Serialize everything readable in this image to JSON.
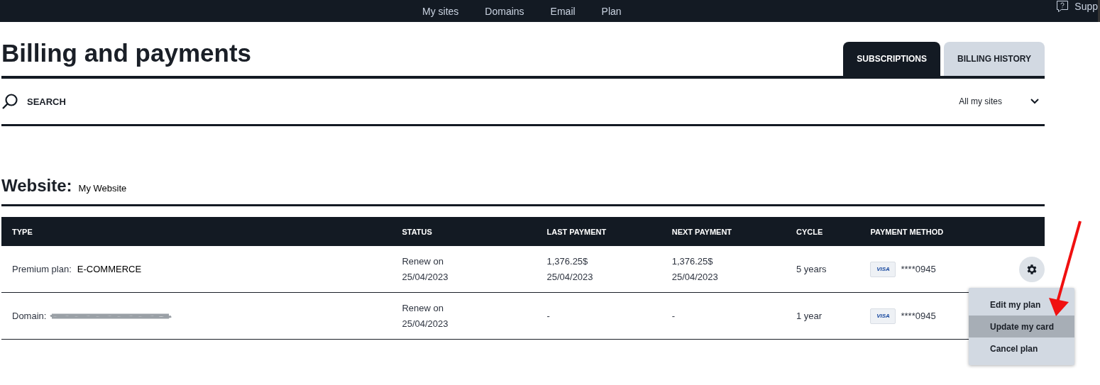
{
  "top_nav": {
    "items": [
      "My sites",
      "Domains",
      "Email",
      "Plan"
    ],
    "support": "Supp"
  },
  "page_title": "Billing and payments",
  "tabs": [
    {
      "label": "SUBSCRIPTIONS",
      "selected": true
    },
    {
      "label": "BILLING HISTORY",
      "selected": false
    }
  ],
  "search": {
    "label": "SEARCH"
  },
  "site_filter": {
    "value": "All my sites"
  },
  "website": {
    "label": "Website:",
    "name": "My Website"
  },
  "table": {
    "columns": [
      "TYPE",
      "STATUS",
      "LAST PAYMENT",
      "NEXT PAYMENT",
      "CYCLE",
      "PAYMENT METHOD"
    ],
    "rows": [
      {
        "type_label": "Premium plan:",
        "type_value": "E-COMMERCE",
        "redacted": false,
        "status": [
          "Renew on",
          "25/04/2023"
        ],
        "last_payment": [
          "1,376.25$",
          "25/04/2023"
        ],
        "next_payment": [
          "1,376.25$",
          "25/04/2023"
        ],
        "cycle": "5 years",
        "card_brand": "VISA",
        "card_number": "****0945",
        "settings_button": true
      },
      {
        "type_label": "Domain:",
        "redacted": true,
        "status": [
          "Renew on",
          "25/04/2023"
        ],
        "last_payment": [
          "-"
        ],
        "next_payment": [
          "-"
        ],
        "cycle": "1 year",
        "card_brand": "VISA",
        "card_number": "****0945",
        "settings_button": false
      }
    ]
  },
  "action_menu": {
    "items": [
      {
        "label": "Edit my plan",
        "selected": false
      },
      {
        "label": "Update my card",
        "selected": true
      },
      {
        "label": "Cancel plan",
        "selected": false
      }
    ]
  }
}
